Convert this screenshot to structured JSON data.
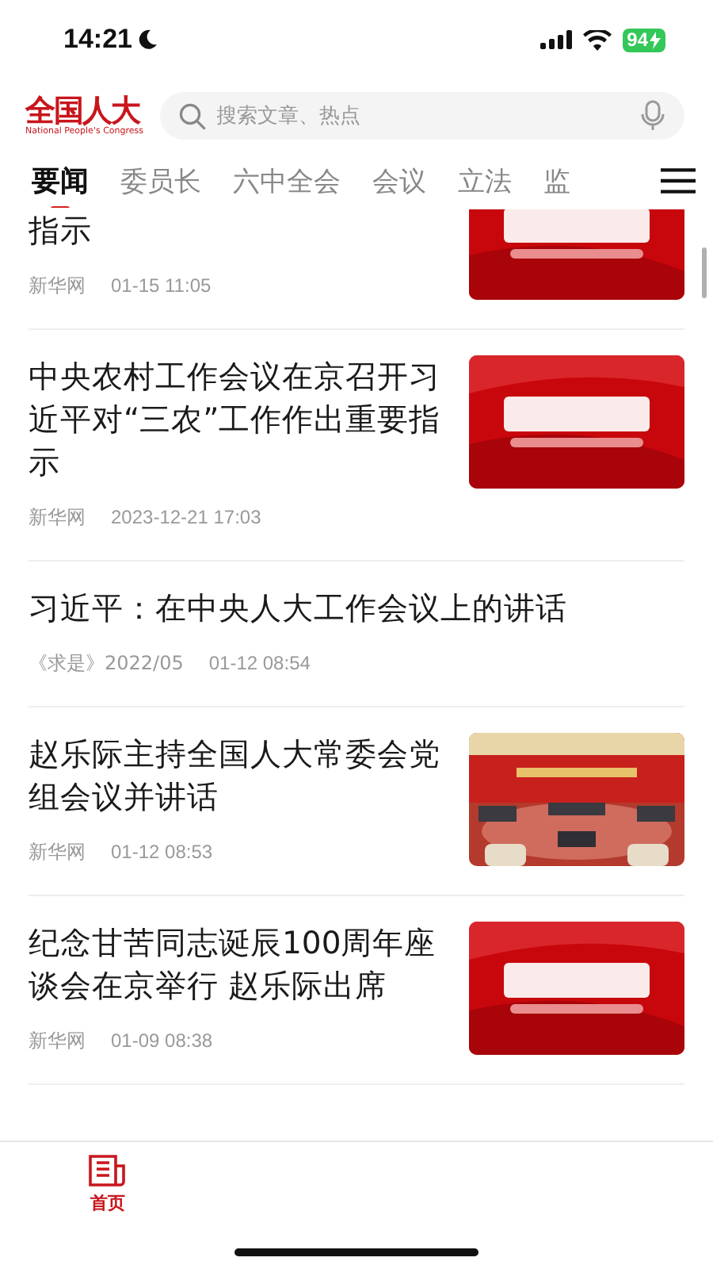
{
  "status_bar": {
    "time": "14:21",
    "battery": "94"
  },
  "header": {
    "logo": "全国人大",
    "logo_subtitle": "National People's Congress",
    "search": {
      "placeholder": "搜索文章、热点"
    }
  },
  "tabs": [
    {
      "label": "要闻",
      "selected": true
    },
    {
      "label": "委员长",
      "selected": false
    },
    {
      "label": "六中全会",
      "selected": false
    },
    {
      "label": "会议",
      "selected": false
    },
    {
      "label": "立法",
      "selected": false
    },
    {
      "label": "监",
      "selected": false
    }
  ],
  "articles": [
    {
      "title": "指示",
      "source": "新华网",
      "time": "01-15 11:05"
    },
    {
      "title": "中央农村工作会议在京召开习近平对“三农”工作作出重要指示",
      "source": "新华网",
      "time": "2023-12-21 17:03"
    },
    {
      "title": "习近平：在中央人大工作会议上的讲话",
      "source": "《求是》2022/05",
      "time": "01-12 08:54"
    },
    {
      "title": "赵乐际主持全国人大常委会党组会议并讲话",
      "source": "新华网",
      "time": "01-12 08:53"
    },
    {
      "title": "纪念甘苦同志诞辰100周年座谈会在京举行 赵乐际出席",
      "source": "新华网",
      "time": "01-09 08:38"
    }
  ],
  "bottom_nav": [
    {
      "label": "首页",
      "selected": true
    }
  ]
}
